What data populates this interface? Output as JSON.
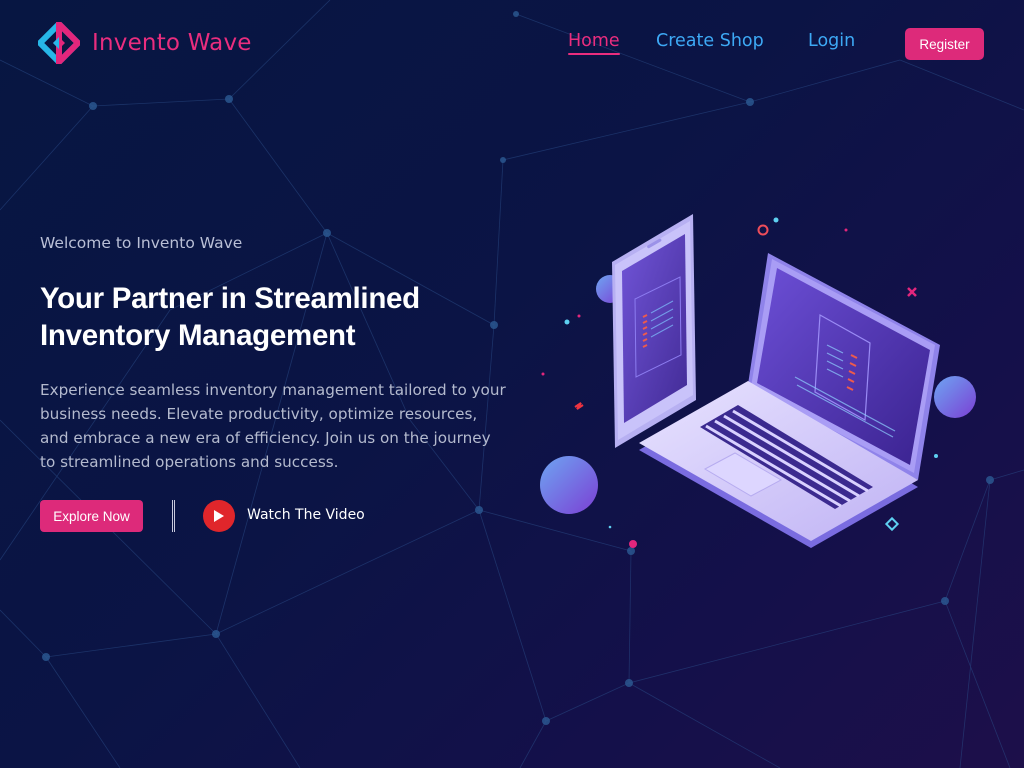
{
  "brand": {
    "name": "Invento Wave",
    "logo_icon": "diamond-logo-icon",
    "colors": {
      "accent": "#dd2a7a",
      "link": "#3da9f5"
    }
  },
  "nav": {
    "items": [
      {
        "label": "Home",
        "active": true
      },
      {
        "label": "Create Shop",
        "active": false
      },
      {
        "label": "Login",
        "active": false
      }
    ],
    "register_label": "Register"
  },
  "hero": {
    "welcome": "Welcome to Invento Wave",
    "title_line1": "Your Partner in Streamlined",
    "title_line2": "Inventory Management",
    "description": "Experience seamless inventory management tailored to your business needs. Elevate productivity, optimize resources, and embrace a new era of efficiency. Join us on the journey to streamlined operations and success.",
    "explore_label": "Explore Now",
    "watch_label": "Watch The Video",
    "play_icon": "play-icon"
  }
}
